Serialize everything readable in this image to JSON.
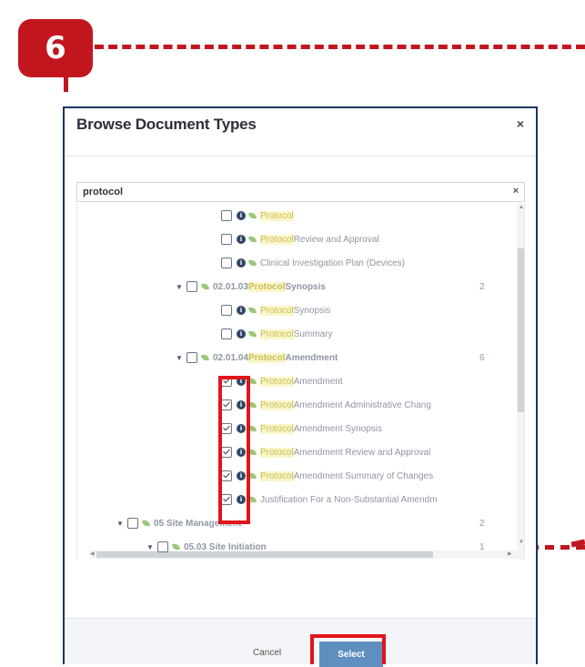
{
  "step": {
    "number": "6",
    "color": "#c2161e"
  },
  "dialog": {
    "title": "Browse Document Types",
    "close_icon": "×",
    "search": {
      "value": "protocol",
      "clear_icon": "×"
    },
    "tree": [
      {
        "caret": "",
        "checked": false,
        "info": true,
        "pre": "",
        "hl": "Protocol",
        "post": "",
        "count": ""
      },
      {
        "caret": "",
        "checked": false,
        "info": true,
        "pre": "",
        "hl": "Protocol",
        "post": " Review and Approval",
        "count": ""
      },
      {
        "caret": "",
        "checked": false,
        "info": true,
        "pre": "Clinical Investigation Plan (Devices)",
        "hl": "",
        "post": "",
        "count": ""
      },
      {
        "caret": "▼",
        "checked": false,
        "info": false,
        "pre": "02.01.03 ",
        "hl": "Protocol",
        "post": " Synopsis",
        "count": "2"
      },
      {
        "caret": "",
        "checked": false,
        "info": true,
        "pre": "",
        "hl": "Protocol",
        "post": " Synopsis",
        "count": ""
      },
      {
        "caret": "",
        "checked": false,
        "info": true,
        "pre": "",
        "hl": "Protocol",
        "post": " Summary",
        "count": ""
      },
      {
        "caret": "▼",
        "checked": false,
        "info": false,
        "pre": "02.01.04 ",
        "hl": "Protocol",
        "post": " Amendment",
        "count": "6"
      },
      {
        "caret": "",
        "checked": true,
        "info": true,
        "pre": "",
        "hl": "Protocol",
        "post": " Amendment",
        "count": ""
      },
      {
        "caret": "",
        "checked": true,
        "info": true,
        "pre": "",
        "hl": "Protocol",
        "post": " Amendment Administrative Chang",
        "count": ""
      },
      {
        "caret": "",
        "checked": true,
        "info": true,
        "pre": "",
        "hl": "Protocol",
        "post": " Amendment Synopsis",
        "count": ""
      },
      {
        "caret": "",
        "checked": true,
        "info": true,
        "pre": "",
        "hl": "Protocol",
        "post": " Amendment Review and Approval",
        "count": ""
      },
      {
        "caret": "",
        "checked": true,
        "info": true,
        "pre": "",
        "hl": "Protocol",
        "post": " Amendment Summary of Changes",
        "count": ""
      },
      {
        "caret": "",
        "checked": true,
        "info": true,
        "pre": "Justification For a Non-Substantial Amendm",
        "hl": "",
        "post": "",
        "count": ""
      },
      {
        "caret": "▼",
        "checked": false,
        "info": false,
        "pre": "05 Site Management",
        "hl": "",
        "post": "",
        "count": "2"
      },
      {
        "caret": "▼",
        "checked": false,
        "info": false,
        "pre": "05.03 Site Initiation",
        "hl": "",
        "post": "",
        "count": "1"
      }
    ],
    "footer": {
      "cancel_label": "Cancel",
      "select_label": "Select"
    }
  }
}
